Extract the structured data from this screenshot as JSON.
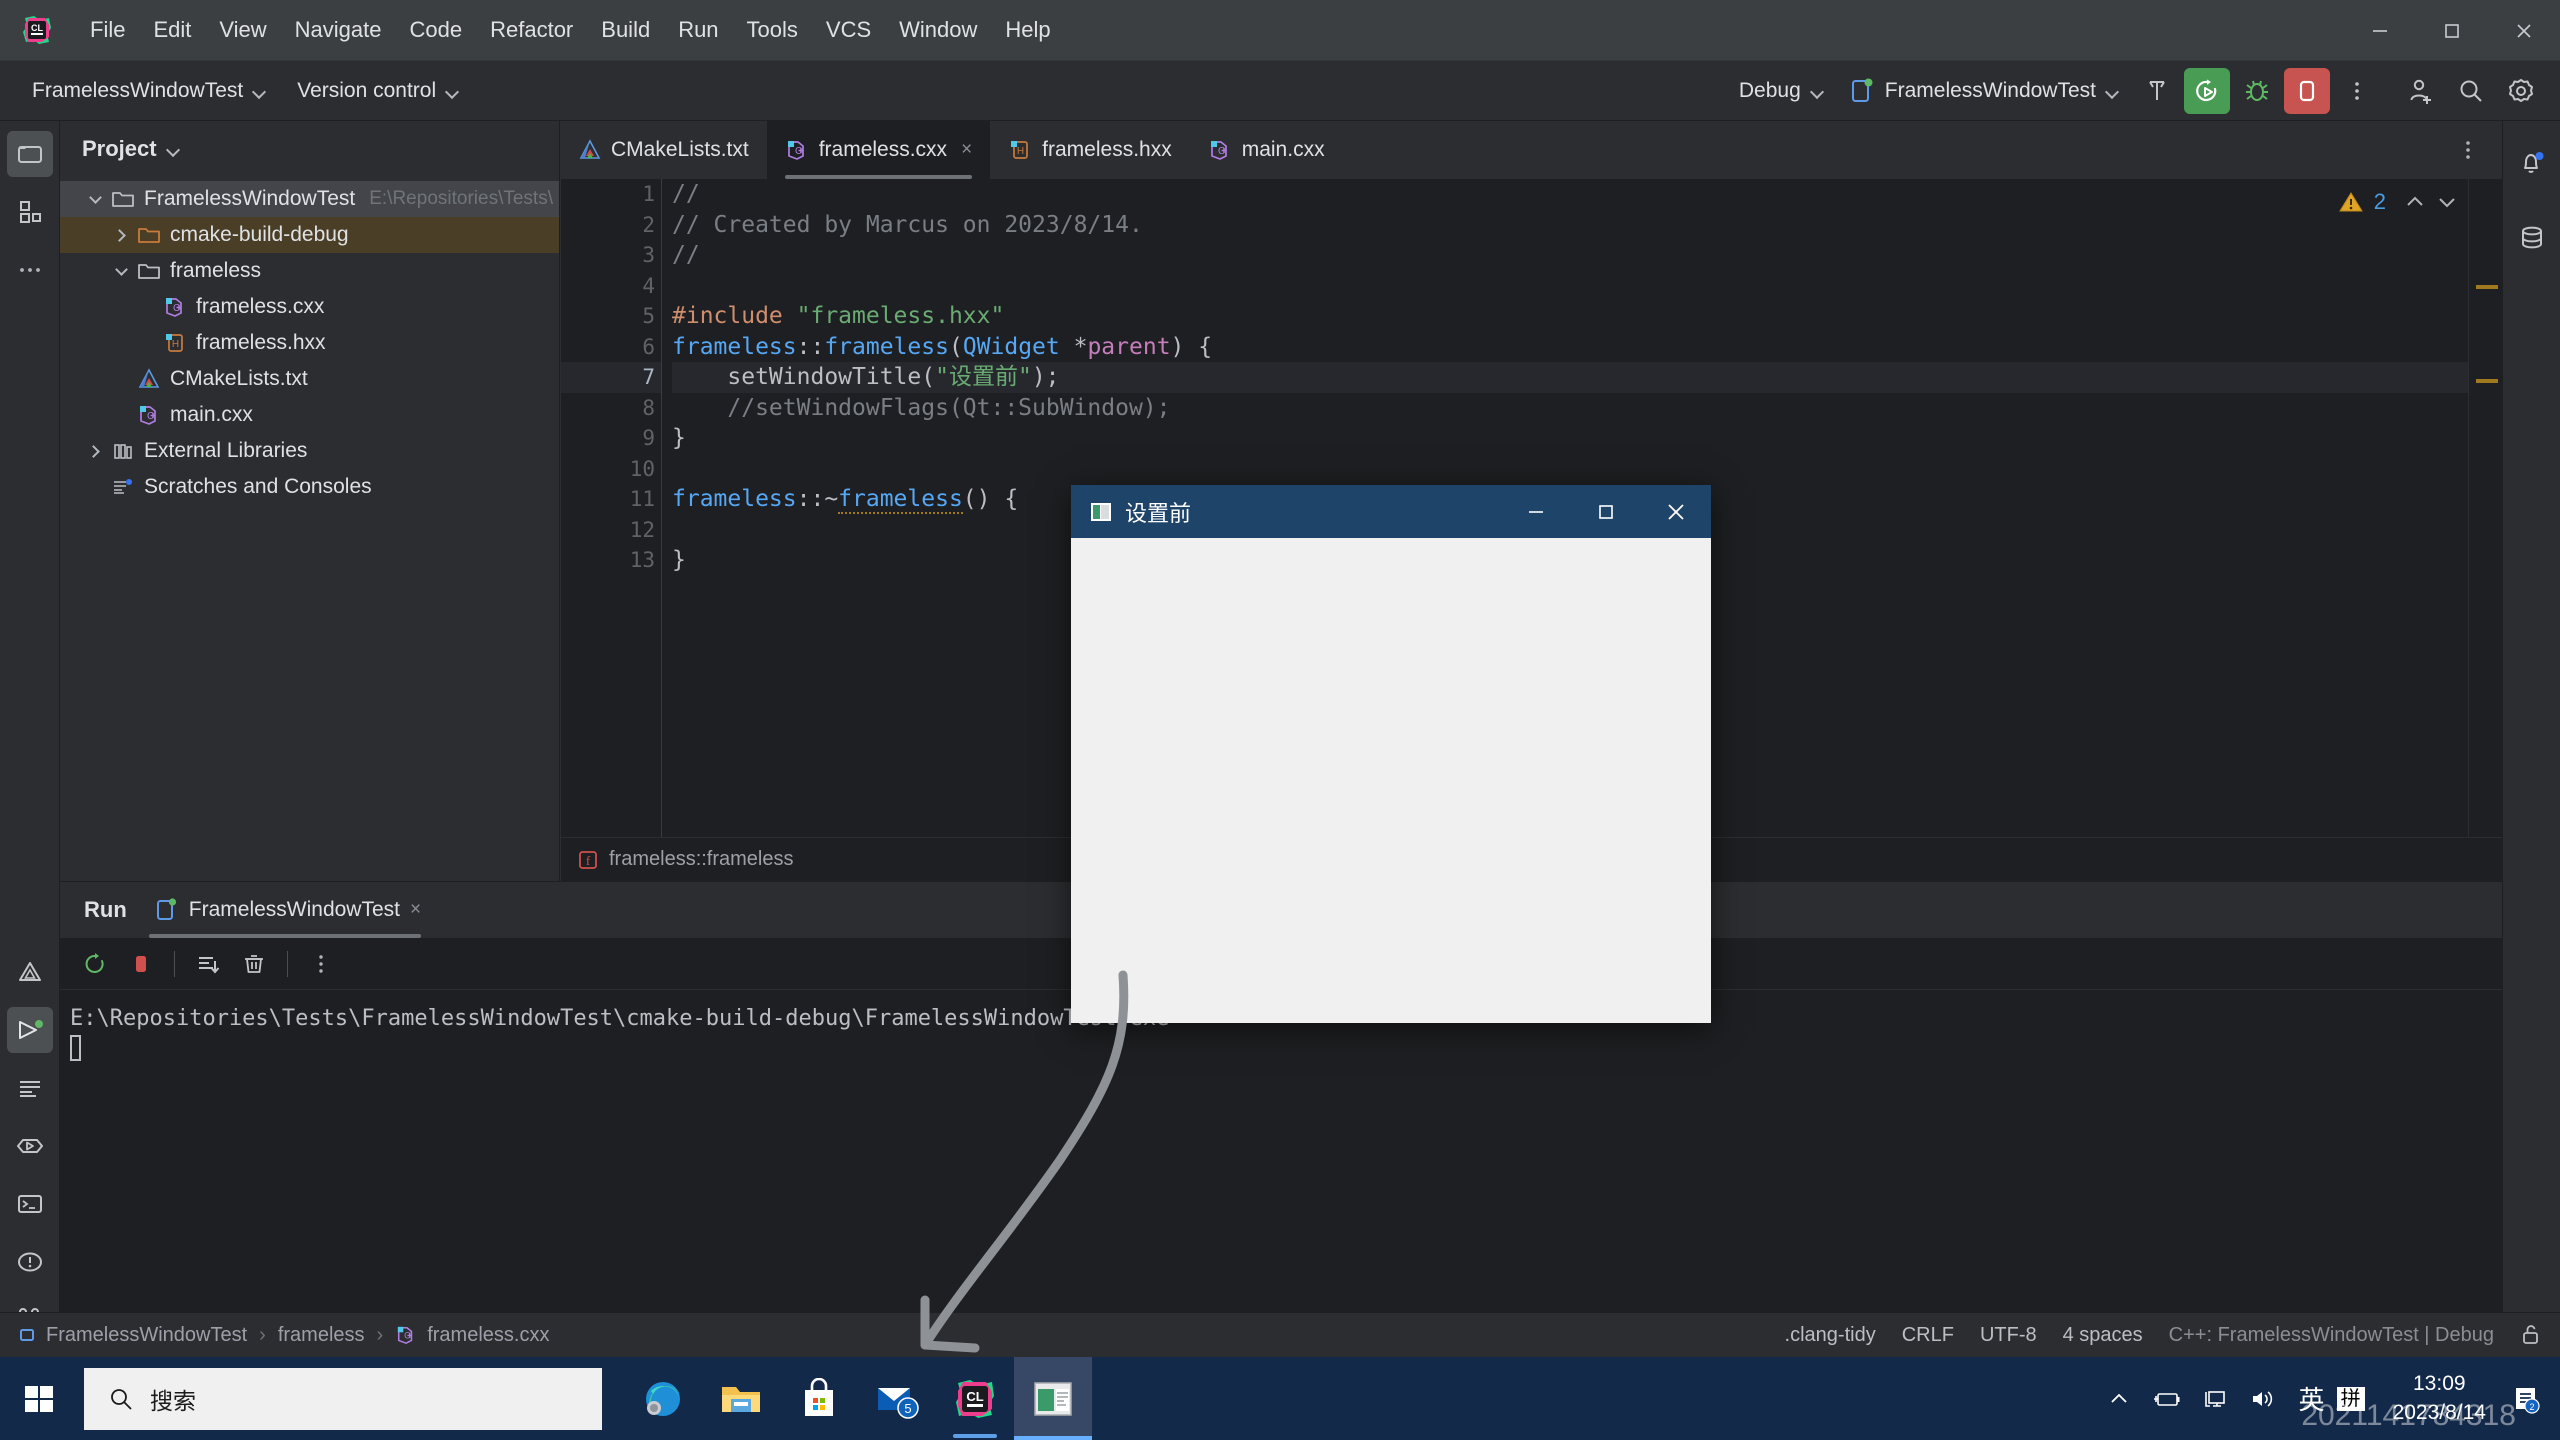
{
  "app": {
    "name": "CLion",
    "logo_text": "CL"
  },
  "menubar": {
    "items": [
      "File",
      "Edit",
      "View",
      "Navigate",
      "Code",
      "Refactor",
      "Build",
      "Run",
      "Tools",
      "VCS",
      "Window",
      "Help"
    ],
    "window_controls": [
      "minimize",
      "maximize",
      "close"
    ]
  },
  "toolbar": {
    "project_chip": "FramelessWindowTest",
    "vcs_chip": "Version control",
    "run_mode": "Debug",
    "run_config": "FramelessWindowTest",
    "icons": [
      "hammer-build-icon",
      "run-with-coverage-icon",
      "debug-bug-icon",
      "stop-icon",
      "more-actions-icon",
      "add-user-icon",
      "search-icon",
      "settings-gear-icon"
    ]
  },
  "left_strip": {
    "top_icons": [
      "project-folder-icon",
      "structure-icon",
      "more-tool-windows-icon"
    ],
    "bottom_icons": [
      "cmake-icon",
      "run-icon",
      "todo-icon",
      "debug-play-icon",
      "terminal-icon",
      "problems-icon",
      "version-control-branch-icon"
    ]
  },
  "right_strip": {
    "icons": [
      "notifications-bell-icon",
      "database-icon"
    ]
  },
  "project_panel": {
    "title": "Project",
    "tree": [
      {
        "label": "FramelessWindowTest",
        "path": "E:\\Repositories\\Tests\\Frar",
        "icon": "folder-icon",
        "indent": 0,
        "state": "open",
        "selected": true
      },
      {
        "label": "cmake-build-debug",
        "path": "",
        "icon": "folder-excluded-icon",
        "indent": 1,
        "state": "closed",
        "highlight": true
      },
      {
        "label": "frameless",
        "path": "",
        "icon": "folder-icon",
        "indent": 1,
        "state": "open"
      },
      {
        "label": "frameless.cxx",
        "path": "",
        "icon": "cpp-source-icon",
        "indent": 2,
        "state": "leaf"
      },
      {
        "label": "frameless.hxx",
        "path": "",
        "icon": "cpp-header-icon",
        "indent": 2,
        "state": "leaf"
      },
      {
        "label": "CMakeLists.txt",
        "path": "",
        "icon": "cmake-icon",
        "indent": 1,
        "state": "leaf"
      },
      {
        "label": "main.cxx",
        "path": "",
        "icon": "cpp-source-icon",
        "indent": 1,
        "state": "leaf"
      },
      {
        "label": "External Libraries",
        "path": "",
        "icon": "library-icon",
        "indent": 0,
        "state": "closed"
      },
      {
        "label": "Scratches and Consoles",
        "path": "",
        "icon": "scratches-icon",
        "indent": 0,
        "state": "leaf"
      }
    ]
  },
  "editor": {
    "tabs": [
      {
        "label": "CMakeLists.txt",
        "icon": "cmake-icon",
        "active": false,
        "closable": false
      },
      {
        "label": "frameless.cxx",
        "icon": "cpp-source-icon",
        "active": true,
        "closable": true,
        "close_label": "×"
      },
      {
        "label": "frameless.hxx",
        "icon": "cpp-header-icon",
        "active": false,
        "closable": false
      },
      {
        "label": "main.cxx",
        "icon": "cpp-source-icon",
        "active": false,
        "closable": false
      }
    ],
    "inspection_count": "2",
    "inspection_icon": "warning-triangle-icon",
    "line_numbers": [
      "1",
      "2",
      "3",
      "4",
      "5",
      "6",
      "7",
      "8",
      "9",
      "10",
      "11",
      "12",
      "13"
    ],
    "current_line": 7,
    "breadcrumb": "frameless::frameless",
    "breadcrumb_icon": "function-f-icon",
    "code_lines": [
      {
        "n": 1,
        "tokens": [
          {
            "t": "// ",
            "c": "c-comment"
          }
        ]
      },
      {
        "n": 2,
        "tokens": [
          {
            "t": "// Created by Marcus on 2023/8/14.",
            "c": "c-comment"
          }
        ]
      },
      {
        "n": 3,
        "tokens": [
          {
            "t": "//",
            "c": "c-comment"
          }
        ]
      },
      {
        "n": 4,
        "tokens": []
      },
      {
        "n": 5,
        "tokens": [
          {
            "t": "#include ",
            "c": "c-kw"
          },
          {
            "t": "\"frameless.hxx\"",
            "c": "c-str"
          }
        ]
      },
      {
        "n": 6,
        "tokens": [
          {
            "t": "frameless",
            "c": "c-type"
          },
          {
            "t": "::",
            "c": "c-punc"
          },
          {
            "t": "frameless",
            "c": "c-type"
          },
          {
            "t": "(",
            "c": "c-punc"
          },
          {
            "t": "QWidget",
            "c": "c-type"
          },
          {
            "t": " *",
            "c": "c-punc"
          },
          {
            "t": "parent",
            "c": "c-param"
          },
          {
            "t": ") {",
            "c": "c-punc"
          }
        ],
        "gutter_mark": "override-arrow-icon"
      },
      {
        "n": 7,
        "tokens": [
          {
            "t": "    setWindowTitle(",
            "c": "c-punc"
          },
          {
            "t": "\"设置前\"",
            "c": "c-str"
          },
          {
            "t": ");",
            "c": "c-punc"
          }
        ]
      },
      {
        "n": 8,
        "tokens": [
          {
            "t": "    //setWindowFlags(Qt::SubWindow);",
            "c": "c-comment"
          }
        ]
      },
      {
        "n": 9,
        "tokens": [
          {
            "t": "}",
            "c": "c-punc"
          }
        ]
      },
      {
        "n": 10,
        "tokens": []
      },
      {
        "n": 11,
        "tokens": [
          {
            "t": "frameless",
            "c": "c-type"
          },
          {
            "t": "::~",
            "c": "c-punc"
          },
          {
            "t": "frameless",
            "c": "c-type squiggle"
          },
          {
            "t": "() {",
            "c": "c-punc"
          }
        ],
        "gutter_mark": "implemented-arrows-icon"
      },
      {
        "n": 12,
        "tokens": []
      },
      {
        "n": 13,
        "tokens": [
          {
            "t": "}",
            "c": "c-punc"
          }
        ]
      }
    ]
  },
  "run_panel": {
    "title": "Run",
    "tab_label": "FramelessWindowTest",
    "tab_icon": "run-config-icon",
    "tab_close": "×",
    "toolbar_icons": [
      "rerun-icon",
      "stop-icon",
      "scroll-to-end-icon",
      "clear-all-icon",
      "more-options-icon"
    ],
    "console_line": "E:\\Repositories\\Tests\\FramelessWindowTest\\cmake-build-debug\\FramelessWindowTest.exe"
  },
  "status_bar": {
    "breadcrumb": [
      "FramelessWindowTest",
      "frameless",
      "frameless.cxx"
    ],
    "breadcrumb_icons": [
      "project-module-icon",
      "folder-icon",
      "cpp-source-icon"
    ],
    "separator": "›",
    "right_items": [
      ".clang-tidy",
      "CRLF",
      "UTF-8",
      "4 spaces",
      "C++: FramelessWindowTest | Debug"
    ],
    "lock_icon": "unlocked-padlock-icon"
  },
  "qt_window": {
    "title": "设置前",
    "icon": "qt-app-icon",
    "minimize": "—",
    "maximize": "☐",
    "close": "×"
  },
  "taskbar": {
    "start_icon": "windows-start-icon",
    "search_placeholder": "搜索",
    "search_icon": "search-icon",
    "apps": [
      {
        "name": "edge-browser-icon",
        "running": false,
        "active": false
      },
      {
        "name": "file-explorer-icon",
        "running": false,
        "active": false
      },
      {
        "name": "microsoft-store-icon",
        "running": false,
        "active": false
      },
      {
        "name": "mail-icon",
        "running": false,
        "active": false,
        "badge": "5"
      },
      {
        "name": "clion-icon",
        "running": true,
        "active": false
      },
      {
        "name": "frameless-app-icon",
        "running": true,
        "active": true
      }
    ],
    "tray": [
      "show-hidden-icons-chevron",
      "battery-charging-icon",
      "network-icon",
      "volume-icon"
    ],
    "ime_lang": "英",
    "ime_mode": "拼",
    "clock_time": "13:09",
    "clock_date": "2023/8/14",
    "watermark": "2021141784318",
    "notification_icon": "notification-center-icon"
  },
  "annotation": {
    "type": "hand-drawn-arrow",
    "color": "#8e9196"
  },
  "colors": {
    "accent_green": "#499c54",
    "accent_red": "#c75450",
    "warning_yellow": "#a1791f",
    "qt_titlebar": "#1f4469",
    "taskbar": "#13294a",
    "editor_bg": "#1e1f22",
    "panel_bg": "#2b2d30",
    "menubar_bg": "#3c3f41"
  }
}
